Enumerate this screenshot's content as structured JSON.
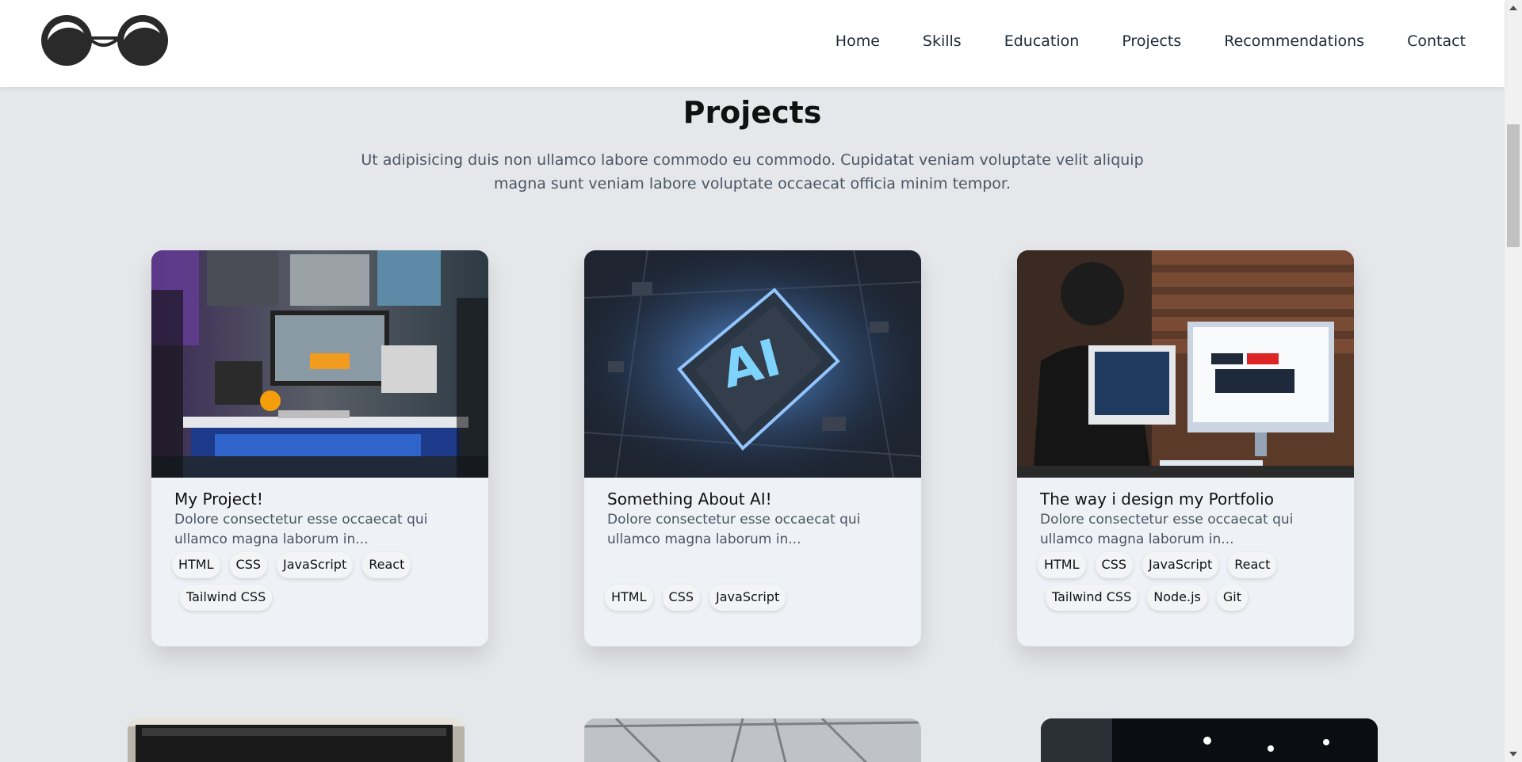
{
  "header": {
    "logo_icon": "glasses-logo-icon",
    "nav": [
      {
        "label": "Home"
      },
      {
        "label": "Skills"
      },
      {
        "label": "Education"
      },
      {
        "label": "Projects"
      },
      {
        "label": "Recommendations"
      },
      {
        "label": "Contact"
      }
    ]
  },
  "section": {
    "title": "Projects",
    "description": "Ut adipisicing duis non ullamco labore commodo eu commodo. Cupidatat veniam voluptate velit aliquip magna sunt veniam labore voluptate occaecat officia minim tempor."
  },
  "projects": [
    {
      "title": "My Project!",
      "description": "Dolore consectetur esse occaecat qui ullamco magna laborum in...",
      "tags": [
        "HTML",
        "CSS",
        "JavaScript",
        "React",
        "Tailwind CSS"
      ]
    },
    {
      "title": "Something About AI!",
      "description": "Dolore consectetur esse occaecat qui ullamco magna laborum in...",
      "tags": [
        "HTML",
        "CSS",
        "JavaScript"
      ],
      "image_text": "AI"
    },
    {
      "title": "The way i design my Portfolio",
      "description": "Dolore consectetur esse occaecat qui ullamco magna laborum in...",
      "tags": [
        "HTML",
        "CSS",
        "JavaScript",
        "React",
        "Tailwind CSS",
        "Node.js",
        "Git"
      ]
    }
  ],
  "colors": {
    "background": "#e5e7eb",
    "card": "#eef1f5",
    "header": "#ffffff",
    "text": "#111111",
    "muted": "#4b5563"
  }
}
